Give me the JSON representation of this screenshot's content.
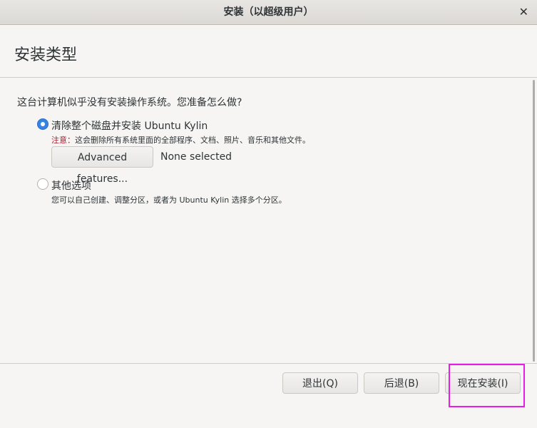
{
  "window": {
    "title": "安装（以超级用户）",
    "close_icon": "close-icon"
  },
  "header": {
    "title": "安装类型"
  },
  "main": {
    "question": "这台计算机似乎没有安装操作系统。您准备怎么做?",
    "options": [
      {
        "label": "清除整个磁盘并安装 Ubuntu Kylin",
        "selected": true,
        "warning_prefix": "注意：",
        "warning": "这会删除所有系统里面的全部程序、文档、照片、音乐和其他文件。",
        "advanced_label": "Advanced features...",
        "advanced_status": "None selected"
      },
      {
        "label": "其他选项",
        "selected": false,
        "description": "您可以自己创建、调整分区，或者为 Ubuntu Kylin 选择多个分区。"
      }
    ]
  },
  "footer": {
    "quit": "退出(Q)",
    "back": "后退(B)",
    "install": "现在安装(I)"
  },
  "colors": {
    "accent": "#3584e4",
    "warning": "#a51d2d",
    "highlight": "#e81ee8"
  }
}
